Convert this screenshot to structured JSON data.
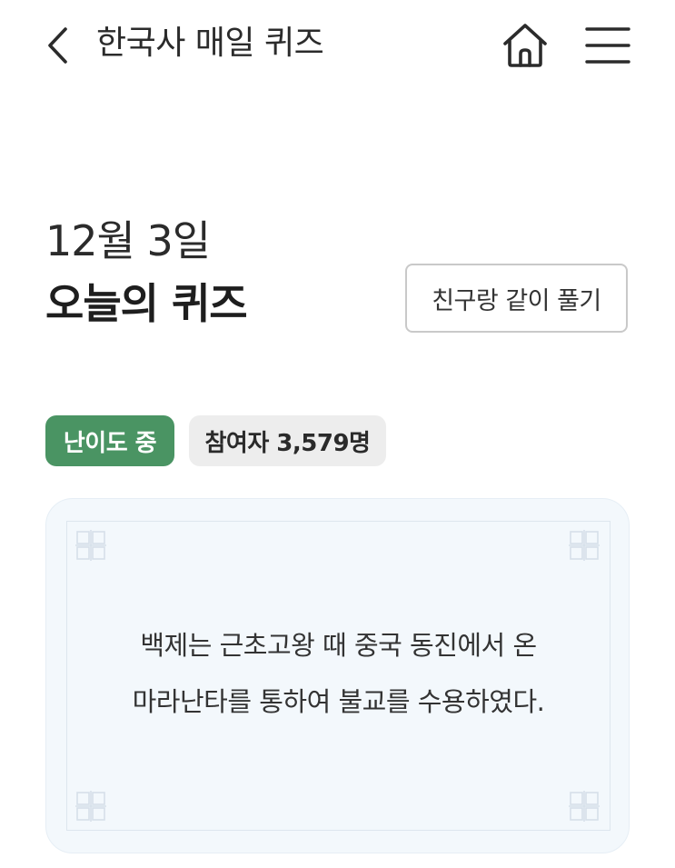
{
  "header": {
    "title": "한국사 매일 퀴즈",
    "back_icon": "chevron-left-icon",
    "home_icon": "home-icon",
    "menu_icon": "hamburger-menu-icon"
  },
  "quiz": {
    "date": "12월 3일",
    "title": "오늘의 퀴즈",
    "together_label": "친구랑 같이 풀기",
    "difficulty_badge": "난이도 중",
    "participants_badge": "참여자 3,579명",
    "question_lines": [
      "백제는 근초고왕 때 중국 동진에서 온",
      "마라난타를 통하여 불교를 수용하였다."
    ]
  },
  "colors": {
    "difficulty_badge_bg": "#4a9463",
    "participants_badge_bg": "#ededed",
    "card_bg": "#f3f8fc"
  }
}
